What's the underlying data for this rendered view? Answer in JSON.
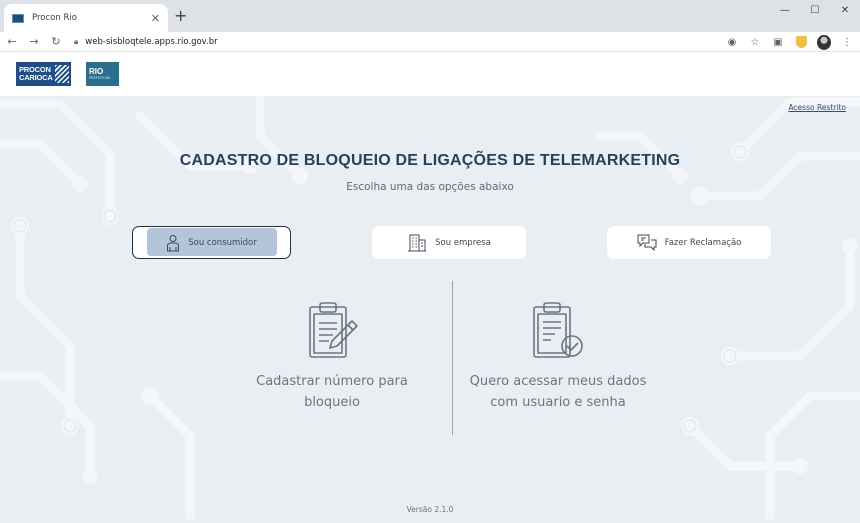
{
  "browser": {
    "tab_title": "Procon Rio",
    "url": "web-sisbloqtele.apps.rio.gov.br"
  },
  "header": {
    "procon_logo_line1": "PROCON",
    "procon_logo_line2": "CARIOCA",
    "rio_logo": "RIO",
    "rio_logo_sub": "PREFEITURA"
  },
  "main": {
    "restricted_access": "Acesso Restrito",
    "title": "CADASTRO DE BLOQUEIO DE LIGAÇÕES DE TELEMARKETING",
    "subtitle": "Escolha uma das opções abaixo",
    "options": [
      {
        "label": "Sou consumidor",
        "icon": "person-icon",
        "selected": true
      },
      {
        "label": "Sou empresa",
        "icon": "building-icon",
        "selected": false
      },
      {
        "label": "Fazer Reclamação",
        "icon": "chat-icon",
        "selected": false
      }
    ],
    "cards": [
      {
        "line1": "Cadastrar número para",
        "line2": "bloqueio",
        "icon": "clipboard-edit-icon"
      },
      {
        "line1": "Quero acessar meus dados",
        "line2": "com usuario e senha",
        "icon": "clipboard-check-icon"
      }
    ],
    "version": "Versão 2.1.0"
  },
  "colors": {
    "brand": "#24425e",
    "selected": "#b3c5d8",
    "background": "#e9eef3"
  }
}
